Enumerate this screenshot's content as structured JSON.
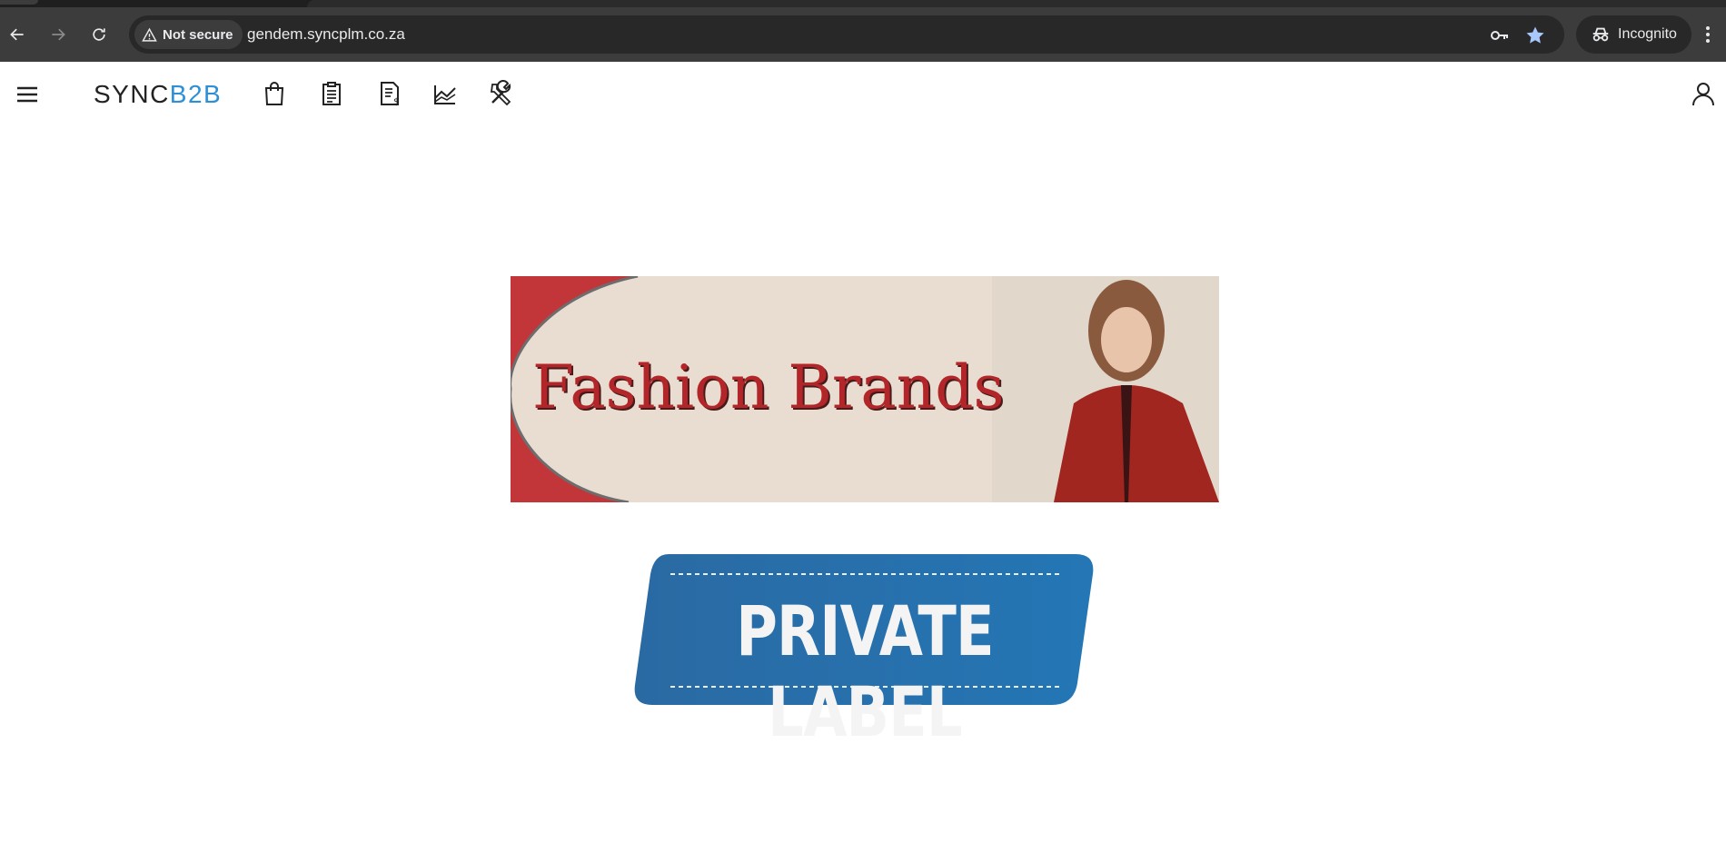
{
  "browser": {
    "security_label": "Not secure",
    "url": "gendem.syncplm.co.za",
    "incognito_label": "Incognito"
  },
  "app": {
    "logo_primary": "SYNC",
    "logo_accent": "B2B",
    "accent_color": "#2d8fd6",
    "nav_icons": [
      "shopping-bag-icon",
      "clipboard-icon",
      "invoice-icon",
      "analytics-chart-icon",
      "tools-icon"
    ],
    "user_icon": "user-icon"
  },
  "banners": {
    "fashion_title": "Fashion Brands",
    "private_label": "PRIVATE LABEL"
  },
  "colors": {
    "fashion_red": "#b2262a",
    "private_blue": "#2a6fa8"
  }
}
